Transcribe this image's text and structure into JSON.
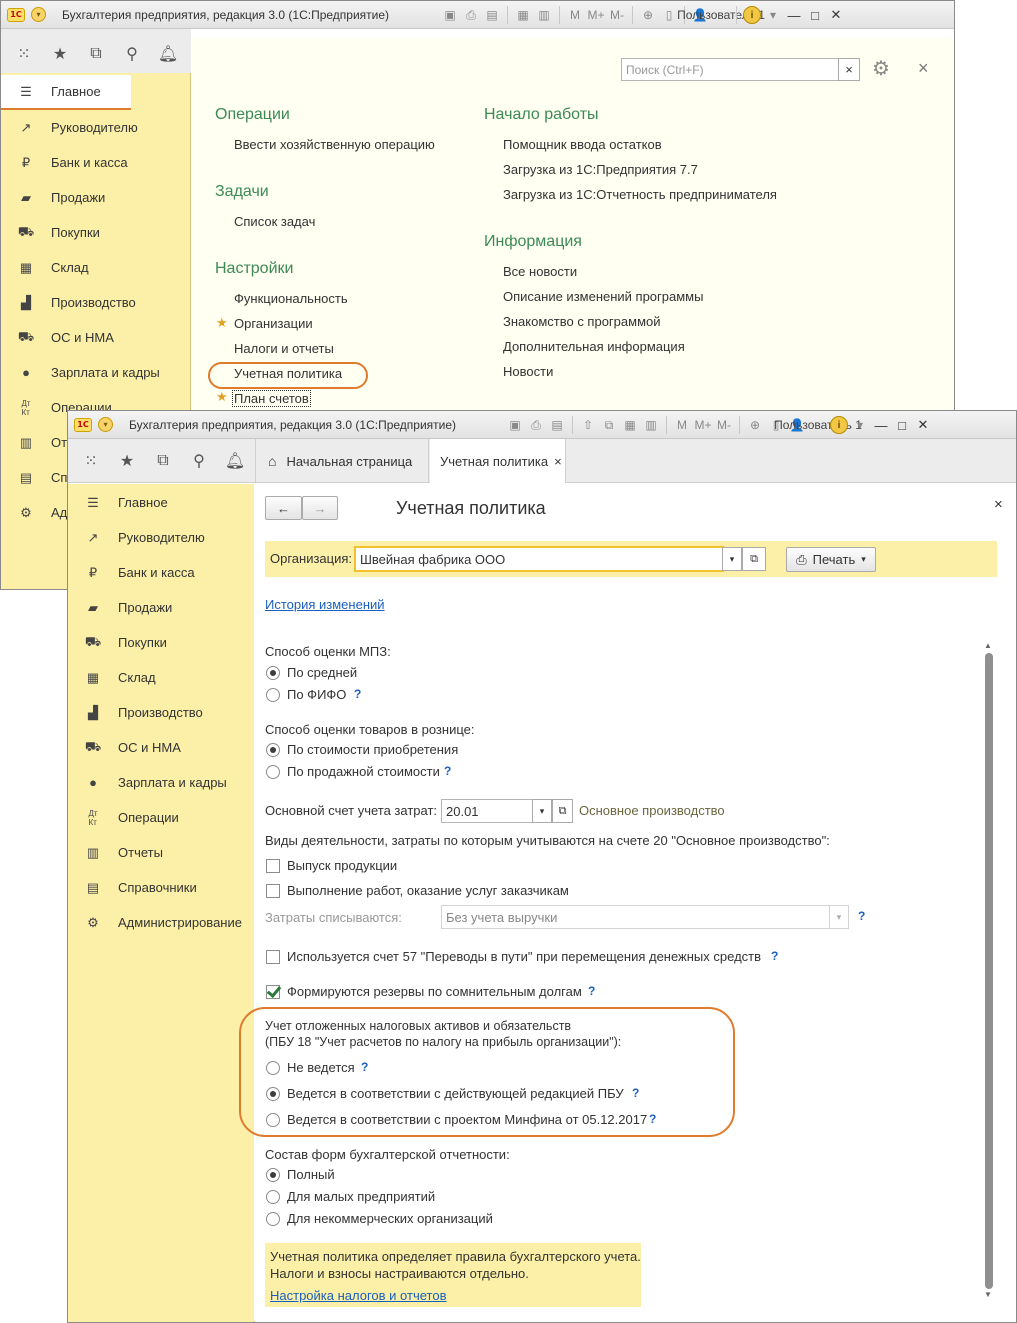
{
  "app_title": "Бухгалтерия предприятия, редакция 3.0 (1С:Предприятие)",
  "logo_text": "1С",
  "user": "Пользователь 1",
  "back_window": {
    "search_placeholder": "Поиск (Ctrl+F)",
    "search_clear": "×",
    "close": "×",
    "sidebar": [
      "Главное",
      "Руководителю",
      "Банк и касса",
      "Продажи",
      "Покупки",
      "Склад",
      "Производство",
      "ОС и НМА",
      "Зарплата и кадры",
      "Операции",
      "Отчеты",
      "Справочники",
      "Администрирование"
    ],
    "sidebar_visible": [
      "Главное",
      "Руководителю",
      "Банк и касса",
      "Продажи",
      "Покупки",
      "Склад",
      "Производство",
      "ОС и НМА",
      "Зарплата и кадры",
      "Операции",
      "От",
      "Сп",
      "Ад"
    ],
    "sections": {
      "operations": {
        "title": "Операции",
        "links": [
          "Ввести хозяйственную операцию"
        ]
      },
      "tasks": {
        "title": "Задачи",
        "links": [
          "Список задач"
        ]
      },
      "settings": {
        "title": "Настройки",
        "links": [
          "Функциональность",
          "Организации",
          "Налоги и отчеты",
          "Учетная политика",
          "План счетов"
        ]
      },
      "start": {
        "title": "Начало работы",
        "links": [
          "Помощник ввода остатков",
          "Загрузка из 1С:Предприятия 7.7",
          "Загрузка из 1С:Отчетность предпринимателя"
        ]
      },
      "info": {
        "title": "Информация",
        "links": [
          "Все новости",
          "Описание изменений программы",
          "Знакомство с программой",
          "Дополнительная информация",
          "Новости"
        ]
      }
    }
  },
  "front_window": {
    "tabs": [
      {
        "label": "Начальная страница",
        "icon": "home-icon"
      },
      {
        "label": "Учетная политика",
        "close": "×"
      }
    ],
    "sidebar": [
      "Главное",
      "Руководителю",
      "Банк и касса",
      "Продажи",
      "Покупки",
      "Склад",
      "Производство",
      "ОС и НМА",
      "Зарплата и кадры",
      "Операции",
      "Отчеты",
      "Справочники",
      "Администрирование"
    ],
    "form": {
      "title": "Учетная политика",
      "close": "×",
      "org_label": "Организация:",
      "org_value": "Швейная фабрика ООО",
      "print_button": "Печать",
      "history_link": "История изменений",
      "mpz_label": "Способ оценки МПЗ:",
      "mpz_options": [
        "По средней",
        "По ФИФО"
      ],
      "retail_label": "Способ оценки товаров в рознице:",
      "retail_options": [
        "По стоимости приобретения",
        "По продажной стоимости"
      ],
      "cost_account_label": "Основной счет учета затрат:",
      "cost_account_value": "20.01",
      "cost_account_name": "Основное производство",
      "activities_label": "Виды деятельности, затраты по которым учитываются на счете 20 \"Основное производство\":",
      "activities": [
        "Выпуск продукции",
        "Выполнение работ, оказание услуг заказчикам"
      ],
      "writeoff_label": "Затраты списываются:",
      "writeoff_value": "Без учета выручки",
      "acc57_label": "Используется счет 57 \"Переводы в пути\" при перемещения денежных средств",
      "reserves_label": "Формируются резервы по сомнительным долгам",
      "deferred_label_1": "Учет отложенных налоговых активов и обязательств",
      "deferred_label_2": "(ПБУ 18 \"Учет расчетов по налогу на прибыль организации\"):",
      "deferred_options": [
        "Не ведется",
        "Ведется в соответствии с действующей редакцией ПБУ",
        "Ведется в соответствии с проектом Минфина от 05.12.2017"
      ],
      "reports_label": "Состав форм бухгалтерской отчетности:",
      "reports_options": [
        "Полный",
        "Для малых предприятий",
        "Для некоммерческих организаций"
      ],
      "note_line1": "Учетная политика определяет правила бухгалтерского учета.",
      "note_line2": "Налоги и взносы настраиваются отдельно.",
      "note_link": "Настройка налогов и отчетов",
      "help": "?"
    }
  },
  "state": {
    "mpz_selected": 0,
    "retail_selected": 0,
    "deferred_selected": 1,
    "reports_selected": 0,
    "reserves_checked": true
  },
  "colors": {
    "accent_green": "#3c8a55",
    "sidebar_yellow": "#fcf0a9",
    "highlight_orange": "#e07b2c",
    "link_blue": "#1b5fbf"
  }
}
